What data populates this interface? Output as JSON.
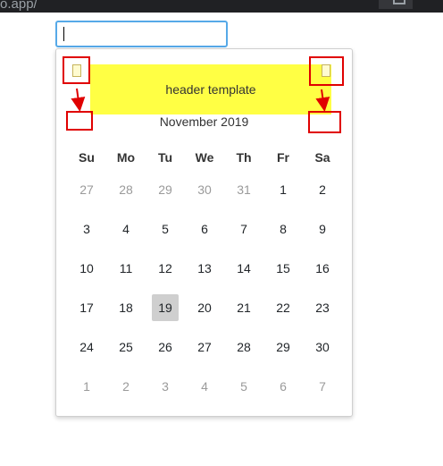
{
  "browser": {
    "url_fragment": "o.app/"
  },
  "date_input": {
    "value": ""
  },
  "calendar": {
    "header_template": "header template",
    "month_title": "November 2019",
    "nav_prev_glyph": "▯",
    "nav_next_glyph": "▯",
    "weekdays": [
      "Su",
      "Mo",
      "Tu",
      "We",
      "Th",
      "Fr",
      "Sa"
    ],
    "weeks": [
      [
        "27",
        "28",
        "29",
        "30",
        "31",
        "1",
        "2"
      ],
      [
        "3",
        "4",
        "5",
        "6",
        "7",
        "8",
        "9"
      ],
      [
        "10",
        "11",
        "12",
        "13",
        "14",
        "15",
        "16"
      ],
      [
        "17",
        "18",
        "19",
        "20",
        "21",
        "22",
        "23"
      ],
      [
        "24",
        "25",
        "26",
        "27",
        "28",
        "29",
        "30"
      ],
      [
        "1",
        "2",
        "3",
        "4",
        "5",
        "6",
        "7"
      ]
    ],
    "today_label": "19"
  },
  "colors": {
    "header_band": "#ffff44",
    "annotation": "#e00000",
    "today_bg": "#cfcfcf",
    "input_focus": "#56a9e8"
  }
}
